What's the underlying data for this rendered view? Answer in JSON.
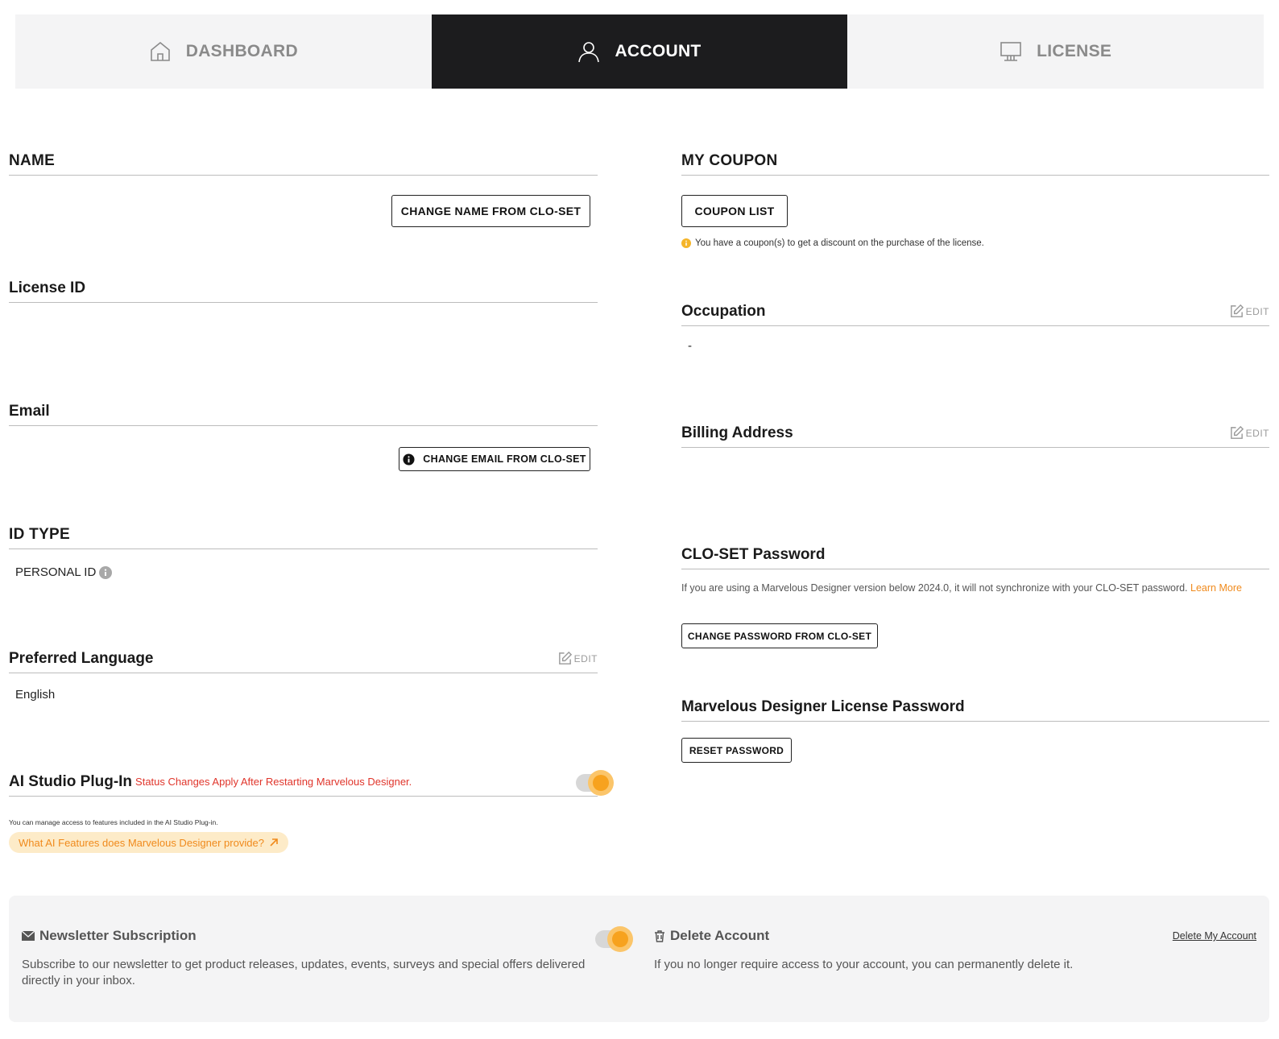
{
  "tabs": [
    {
      "label": "DASHBOARD",
      "icon": "home-icon",
      "active": false
    },
    {
      "label": "ACCOUNT",
      "icon": "user-icon",
      "active": true
    },
    {
      "label": "LICENSE",
      "icon": "monitor-icon",
      "active": false
    }
  ],
  "left": {
    "name": {
      "title": "NAME",
      "button": "CHANGE NAME FROM CLO-SET"
    },
    "license_id": {
      "title": "License ID",
      "value": ""
    },
    "email": {
      "title": "Email",
      "button": "CHANGE EMAIL FROM CLO-SET"
    },
    "id_type": {
      "title": "ID TYPE",
      "value": "PERSONAL ID"
    },
    "language": {
      "title": "Preferred Language",
      "edit": "EDIT",
      "value": "English"
    },
    "ai_plugin": {
      "title": "AI Studio Plug-In",
      "warning": "Status Changes Apply After Restarting Marvelous Designer.",
      "enabled": true,
      "note": "You can manage access to features included in the AI Studio Plug-in.",
      "link": "What AI Features does Marvelous Designer provide?"
    }
  },
  "right": {
    "coupon": {
      "title": "MY COUPON",
      "button": "COUPON LIST",
      "info": "You have a coupon(s) to get a discount on the purchase of the license."
    },
    "occupation": {
      "title": "Occupation",
      "edit": "EDIT",
      "value": "-"
    },
    "billing": {
      "title": "Billing Address",
      "edit": "EDIT",
      "value": ""
    },
    "closet_password": {
      "title": "CLO-SET Password",
      "info": "If you are using a Marvelous Designer version below 2024.0, it will not synchronize with your CLO-SET password.",
      "learn_more": "Learn More",
      "button": "CHANGE PASSWORD FROM CLO-SET"
    },
    "md_password": {
      "title": "Marvelous Designer License Password",
      "button": "RESET PASSWORD"
    }
  },
  "bottom": {
    "newsletter": {
      "title": "Newsletter Subscription",
      "enabled": true,
      "desc": "Subscribe to our newsletter to get product releases, updates, events, surveys and special offers delivered directly in your inbox."
    },
    "delete": {
      "title": "Delete Account",
      "desc": "If you no longer require access to your account, you can permanently delete it.",
      "link": "Delete My Account"
    }
  },
  "colors": {
    "accent": "#f7a21e",
    "warning_red": "#e0352b",
    "link_orange": "#f08a1c",
    "tab_active_bg": "#1c1c1e"
  }
}
